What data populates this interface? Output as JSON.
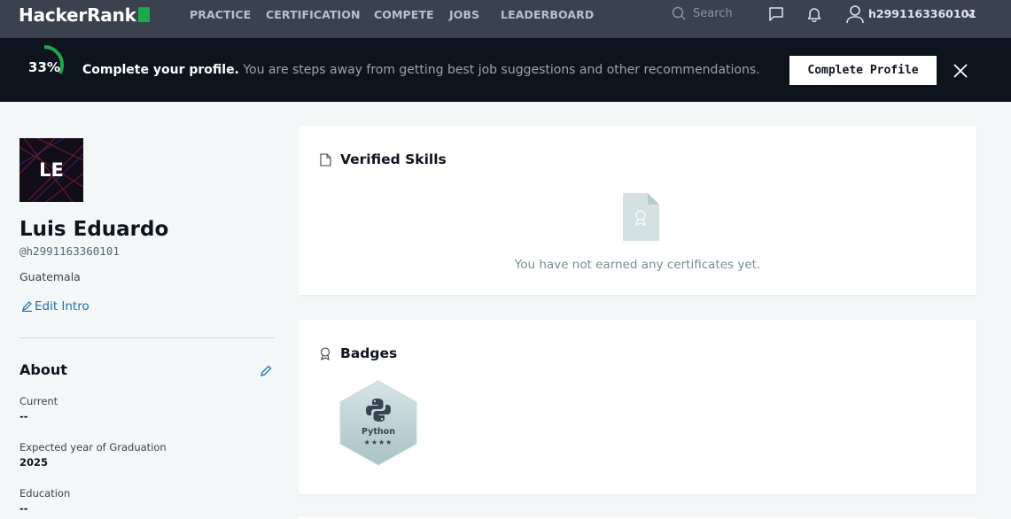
{
  "nav": {
    "logo": "HackerRank",
    "links": [
      "PRACTICE",
      "CERTIFICATION",
      "COMPETE",
      "JOBS",
      "LEADERBOARD"
    ],
    "search_placeholder": "Search",
    "username": "h2991163360101"
  },
  "banner": {
    "progress": "33%",
    "progress_value": 0.33,
    "title": "Complete your profile.",
    "message": "You are steps away from getting best job suggestions and other recommendations.",
    "button": "Complete Profile"
  },
  "profile": {
    "initials": "LE",
    "name": "Luis Eduardo",
    "handle": "@h2991163360101",
    "country": "Guatemala",
    "edit_intro": "Edit Intro"
  },
  "about": {
    "title": "About",
    "fields": [
      {
        "label": "Current",
        "value": "--"
      },
      {
        "label": "Expected year of Graduation",
        "value": "2025"
      },
      {
        "label": "Education",
        "value": "--"
      }
    ]
  },
  "skills": {
    "title": "Verified Skills",
    "empty_message": "You have not earned any certificates yet."
  },
  "badges": {
    "title": "Badges",
    "items": [
      {
        "name": "Python",
        "stars": "★★★★"
      }
    ]
  },
  "colors": {
    "nav_bg": "#39424e",
    "banner_bg": "#0e141e",
    "accent_green": "#1ba94c",
    "link_blue": "#1f6fb2"
  }
}
